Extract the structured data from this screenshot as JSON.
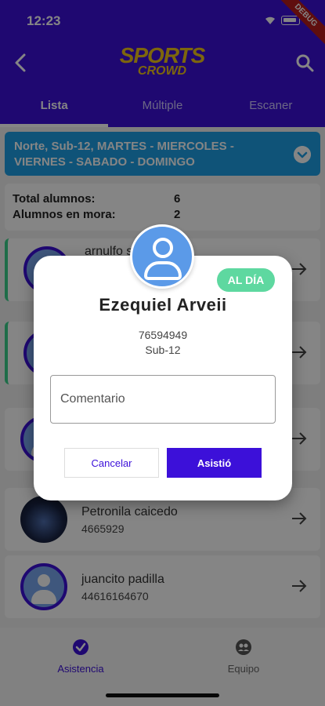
{
  "status_bar": {
    "time": "12:23",
    "debug_label": "DEBUG"
  },
  "header": {
    "logo_line1": "SPORTS",
    "logo_line2": "CROWD"
  },
  "tabs": [
    {
      "label": "Lista",
      "active": true
    },
    {
      "label": "Múltiple",
      "active": false
    },
    {
      "label": "Escaner",
      "active": false
    }
  ],
  "schedule": {
    "label": "Norte, Sub-12, MARTES - MIERCOLES - VIERNES - SABADO - DOMINGO"
  },
  "stats": {
    "total_label": "Total alumnos:",
    "total_value": "6",
    "mora_label": "Alumnos en mora:",
    "mora_value": "2"
  },
  "students": [
    {
      "name": "arnulfo s",
      "id": ""
    },
    {
      "name": "",
      "id": ""
    },
    {
      "name": "",
      "id": ""
    },
    {
      "name": "Petronila caicedo",
      "id": "4665929"
    },
    {
      "name": "juancito padilla",
      "id": "44616164670"
    }
  ],
  "bottom_nav": {
    "asistencia": "Asistencia",
    "equipo": "Equipo"
  },
  "dialog": {
    "status": "AL DÍA",
    "name": "Ezequiel Arveii",
    "id": "76594949",
    "category": "Sub-12",
    "comment_placeholder": "Comentario",
    "cancel_label": "Cancelar",
    "confirm_label": "Asistió"
  },
  "colors": {
    "primary": "#3c10d9",
    "accent_blue": "#1ea0e6",
    "success": "#5ed8a0",
    "logo": "#f0c419"
  }
}
